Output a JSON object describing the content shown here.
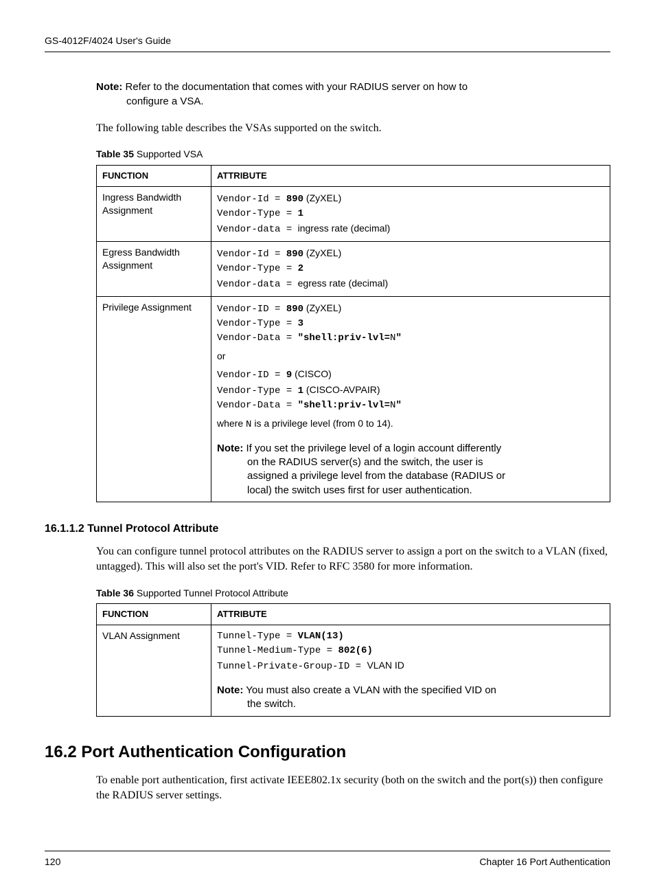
{
  "header": {
    "title": "GS-4012F/4024 User's Guide"
  },
  "top_note": {
    "label": "Note:",
    "line1": "Refer to the documentation that comes with your RADIUS server on how to",
    "line2": "configure a VSA."
  },
  "intro_para": "The following table describes the VSAs supported on the switch.",
  "table35": {
    "caption_bold": "Table 35",
    "caption_rest": "   Supported VSA",
    "col1": "FUNCTION",
    "col2": "ATTRIBUTE",
    "rows": [
      {
        "func": "Ingress Bandwidth Assignment",
        "l1a": "Vendor-Id = ",
        "l1b": "890",
        "l1c": " (ZyXEL)",
        "l2a": "Vendor-Type = ",
        "l2b": "1",
        "l3a": "Vendor-data = ",
        "l3c": " ingress rate (decimal)"
      },
      {
        "func": "Egress Bandwidth Assignment",
        "l1a": "Vendor-Id = ",
        "l1b": "890",
        "l1c": " (ZyXEL)",
        "l2a": "Vendor-Type = ",
        "l2b": "2",
        "l3a": "Vendor-data = ",
        "l3c": " egress rate (decimal)"
      }
    ],
    "row3": {
      "func": "Privilege Assignment",
      "b1_l1a": "Vendor-ID = ",
      "b1_l1b": "890",
      "b1_l1c": " (ZyXEL)",
      "b1_l2a": "Vendor-Type = ",
      "b1_l2b": "3",
      "b1_l3a": "Vendor-Data = ",
      "b1_l3b": "\"shell:priv-lvl=",
      "b1_l3c": "N",
      "b1_l3d": "\"",
      "or": "or",
      "b2_l1a": "Vendor-ID = ",
      "b2_l1b": "9",
      "b2_l1c": " (CISCO)",
      "b2_l2a": "Vendor-Type = ",
      "b2_l2b": "1",
      "b2_l2c": " (CISCO-AVPAIR)",
      "b2_l3a": "Vendor-Data = ",
      "b2_l3b": "\"shell:priv-lvl=",
      "b2_l3c": "N",
      "b2_l3d": "\"",
      "where_a": "where ",
      "where_n": "N",
      "where_b": " is a privilege level (from 0 to 14).",
      "note_label": "Note:",
      "note_l1": "If you set the privilege level of a login account differently",
      "note_l2": "on the RADIUS server(s) and the switch, the user is",
      "note_l3": "assigned a privilege level from the database (RADIUS or",
      "note_l4": "local) the switch uses first for user authentication."
    }
  },
  "sub_heading": "16.1.1.2  Tunnel Protocol Attribute",
  "tunnel_para": "You can configure tunnel protocol attributes on the RADIUS server to assign a port on the switch to a VLAN (fixed, untagged). This will also set the port's VID. Refer to RFC 3580 for more information.",
  "table36": {
    "caption_bold": "Table 36",
    "caption_rest": "   Supported Tunnel Protocol Attribute",
    "col1": "FUNCTION",
    "col2": "ATTRIBUTE",
    "row": {
      "func": "VLAN Assignment",
      "l1a": "Tunnel-Type = ",
      "l1b": "VLAN(13)",
      "l2a": "Tunnel-Medium-Type = ",
      "l2b": "802(6)",
      "l3a": "Tunnel-Private-Group-ID = ",
      "l3c": " VLAN ID",
      "note_label": "Note:",
      "note_l1": "You must also create a VLAN with the specified VID on",
      "note_l2": "the switch."
    }
  },
  "section_heading": "16.2  Port Authentication Configuration",
  "section_para": "To enable port authentication, first activate IEEE802.1x security (both on the switch and the port(s)) then configure the RADIUS server settings.",
  "footer": {
    "page": "120",
    "chapter": "Chapter 16 Port Authentication"
  }
}
